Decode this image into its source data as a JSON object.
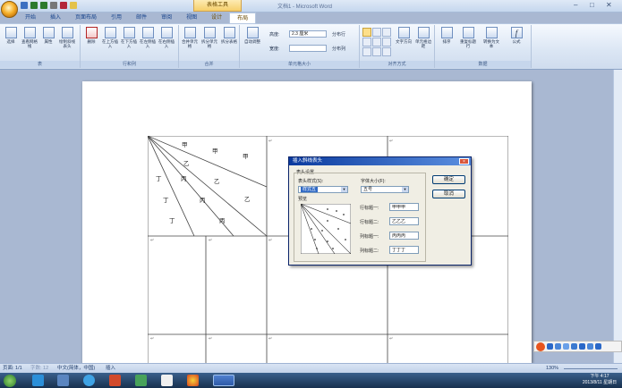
{
  "window": {
    "title": "文档1 - Microsoft Word",
    "context_tab": "表格工具",
    "controls": [
      "–",
      "□",
      "✕"
    ]
  },
  "tabs": [
    "开始",
    "插入",
    "页面布局",
    "引用",
    "邮件",
    "审阅",
    "视图",
    "设计",
    "布局"
  ],
  "active_tab": "布局",
  "ribbon": {
    "groups": [
      {
        "label": "表",
        "buttons": [
          "选择",
          "查看网格线",
          "属性",
          "绘制斜线表头"
        ]
      },
      {
        "label": "行和列",
        "buttons": [
          "删除",
          "在上方插入",
          "在下方插入",
          "在左侧插入",
          "在右侧插入"
        ]
      },
      {
        "label": "合并",
        "buttons": [
          "合并单元格",
          "拆分单元格",
          "拆分表格"
        ]
      },
      {
        "label": "单元格大小",
        "buttons": [
          "自动调整"
        ],
        "height_label": "高度:",
        "height_value": "2.3 厘米",
        "width_label": "宽度:",
        "width_value": "",
        "distribute_rows": "分布行",
        "distribute_cols": "分布列"
      },
      {
        "label": "对齐方式",
        "buttons": [
          "文字方向",
          "单元格边距"
        ]
      },
      {
        "label": "数据",
        "buttons": [
          "排序",
          "重复标题行",
          "转换为文本",
          "公式"
        ]
      }
    ]
  },
  "document": {
    "diagonal_header": {
      "row1": [
        "甲",
        "甲",
        "甲"
      ],
      "row2": [
        "乙",
        "乙",
        "乙"
      ],
      "row3": [
        "丙",
        "丙",
        "丙"
      ],
      "row4": [
        "丁",
        "丁",
        "丁"
      ]
    },
    "cell_mark": "↵"
  },
  "dialog": {
    "title": "插入斜线表头",
    "close": "×",
    "section": "表头设置",
    "style_label": "表头样式(S):",
    "style_value": "样式五",
    "font_label": "字体大小(F):",
    "font_value": "五号",
    "preview_label": "预览",
    "fields": [
      {
        "label": "行标题一:",
        "value": "甲甲甲"
      },
      {
        "label": "行标题二:",
        "value": "乙乙乙"
      },
      {
        "label": "列标题一:",
        "value": "丙丙丙"
      },
      {
        "label": "列标题二:",
        "value": "丁丁丁"
      }
    ],
    "ok": "确定",
    "cancel": "取消"
  },
  "status": {
    "page": "页面: 1/1",
    "words": "字数: 12",
    "lang": "中文(简体，中国)",
    "mode": "插入",
    "zoom": "130%"
  },
  "taskbar": {
    "time": "下午 4:17",
    "date": "2013/8/11 星期日"
  },
  "colors": {
    "ribbon_text": "#15428b",
    "context": "#f6cf6b",
    "dialog_title": "#0a3a9e"
  }
}
